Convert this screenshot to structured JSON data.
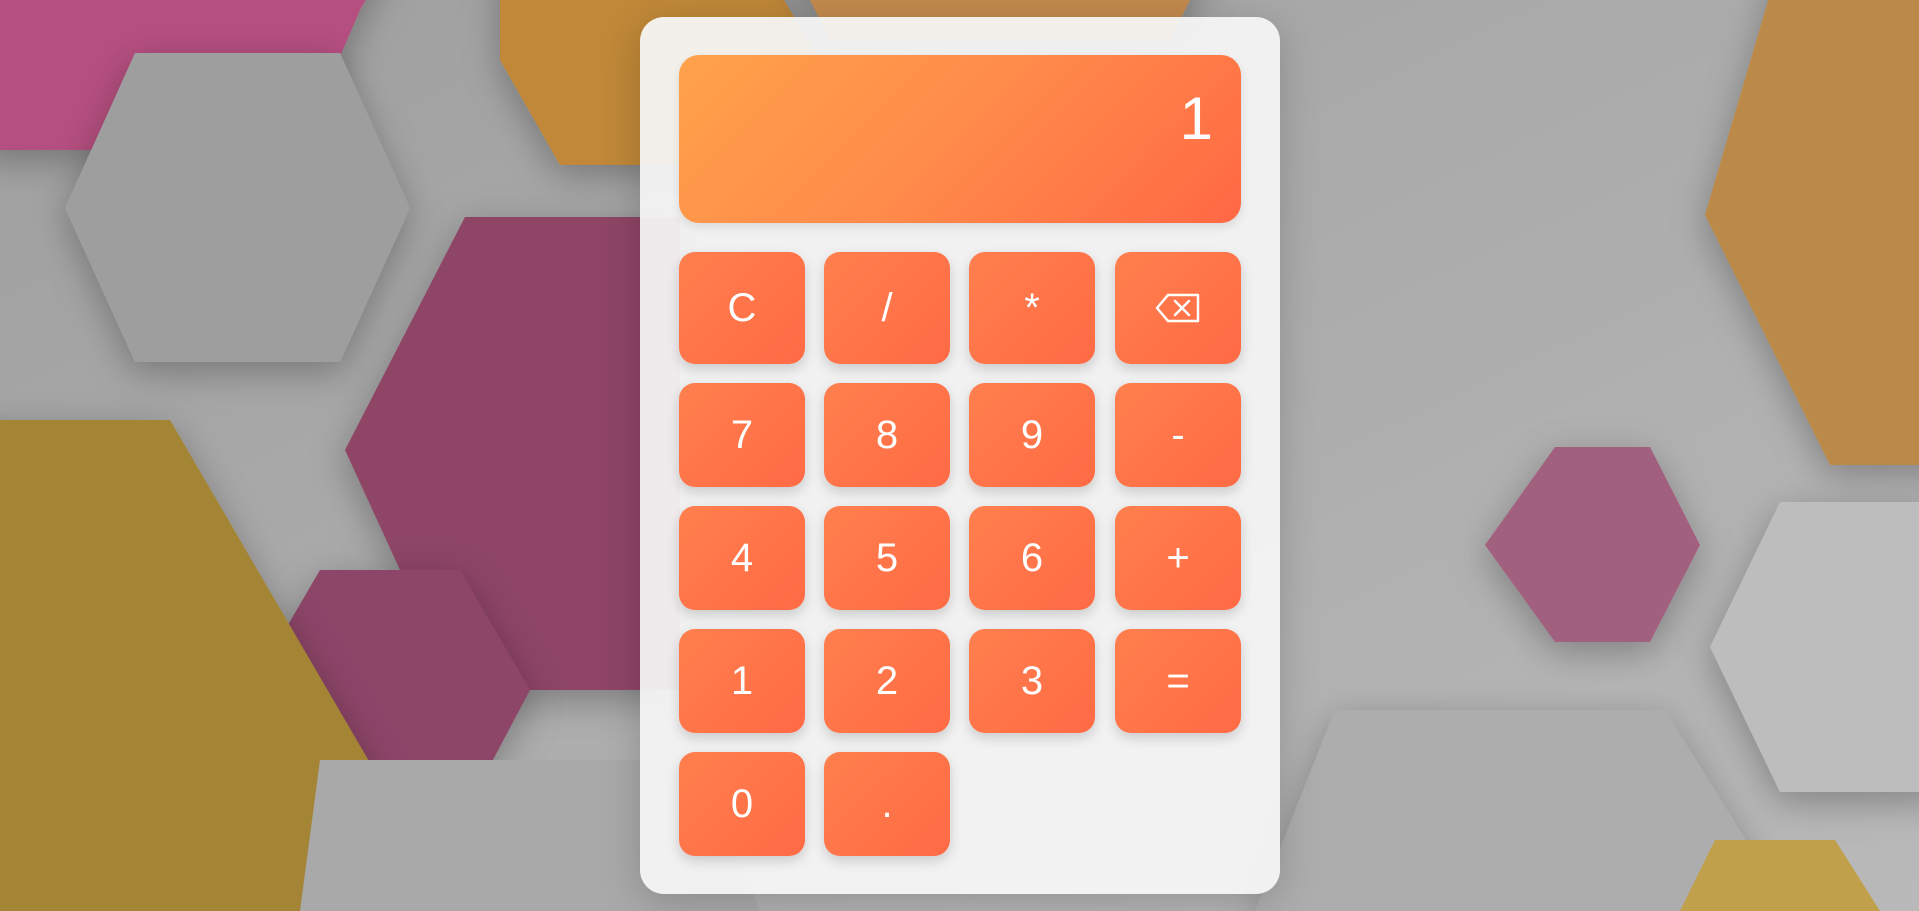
{
  "display": {
    "value": "1"
  },
  "keys": {
    "clear": "C",
    "divide": "/",
    "multiply": "*",
    "seven": "7",
    "eight": "8",
    "nine": "9",
    "minus": "-",
    "four": "4",
    "five": "5",
    "six": "6",
    "plus": "+",
    "one": "1",
    "two": "2",
    "three": "3",
    "equals": "=",
    "zero": "0",
    "decimal": "."
  },
  "backspace_icon": "backspace-icon",
  "colors": {
    "accent_start": "#ffa24a",
    "accent_end": "#ff6844",
    "key": "#ff7449",
    "panel": "#f4f4f4",
    "background": "#b3b3b3"
  }
}
